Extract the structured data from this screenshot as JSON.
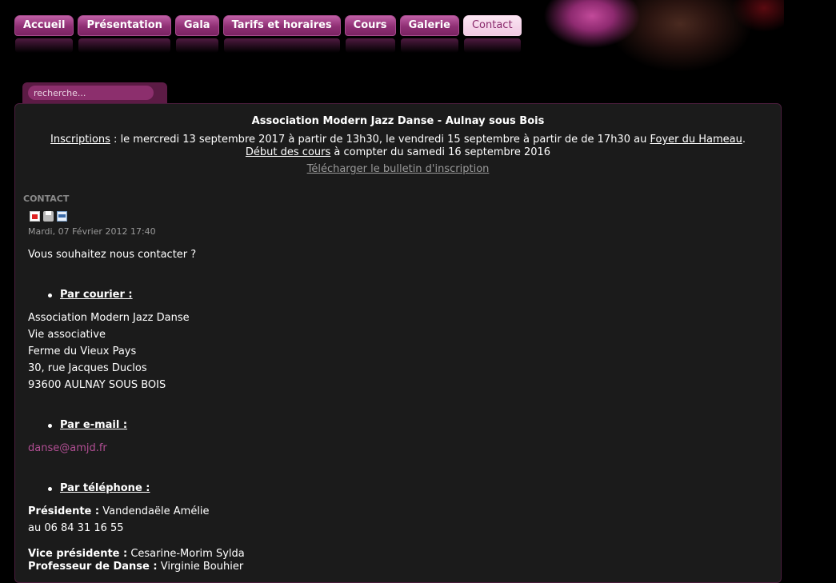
{
  "nav": {
    "items": [
      "Accueil",
      "Présentation",
      "Gala",
      "Tarifs et horaires",
      "Cours",
      "Galerie",
      "Contact"
    ],
    "active": "Contact"
  },
  "search": {
    "placeholder": "recherche..."
  },
  "banner": {
    "title": "Association Modern Jazz Danse - Aulnay sous Bois",
    "inscriptions_label": "Inscriptions",
    "inscriptions_text": " : le mercredi 13 septembre 2017 à partir de 13h30, le vendredi 15 septembre à partir de de 17h30 au ",
    "venue_link": "Foyer du Hameau",
    "venue_end": ".",
    "courses_label": "Début des cours",
    "courses_text": " à compter du samedi 16 septembre 2016",
    "download_link": "Télécharger le bulletin d'inscription"
  },
  "article": {
    "section": "CONTACT",
    "icons": [
      "pdf-icon",
      "print-icon",
      "email-icon"
    ],
    "date": "Mardi, 07 Février 2012 17:40",
    "intro": "Vous souhaitez nous contacter ?",
    "mail_heading": "Par courier :",
    "address": [
      "Association Modern Jazz Danse",
      "Vie associative",
      "Ferme du Vieux Pays",
      "30, rue Jacques Duclos",
      "93600 AULNAY SOUS BOIS"
    ],
    "email_heading": "Par e-mail :",
    "email": "danse@amjd.fr",
    "phone_heading": "Par téléphone :",
    "president_label": "Présidente :",
    "president_name": " Vandendaële Amélie",
    "president_phone": "au 06 84 31 16 55",
    "vp_label": "Vice présidente :",
    "vp_name": " Cesarine-Morim Sylda",
    "teacher_label": "Professeur de Danse :",
    "teacher_name": " Virginie Bouhier"
  },
  "colors": {
    "accent": "#8f2f74",
    "link": "#b14e93",
    "panel": "#1b1b1b"
  }
}
